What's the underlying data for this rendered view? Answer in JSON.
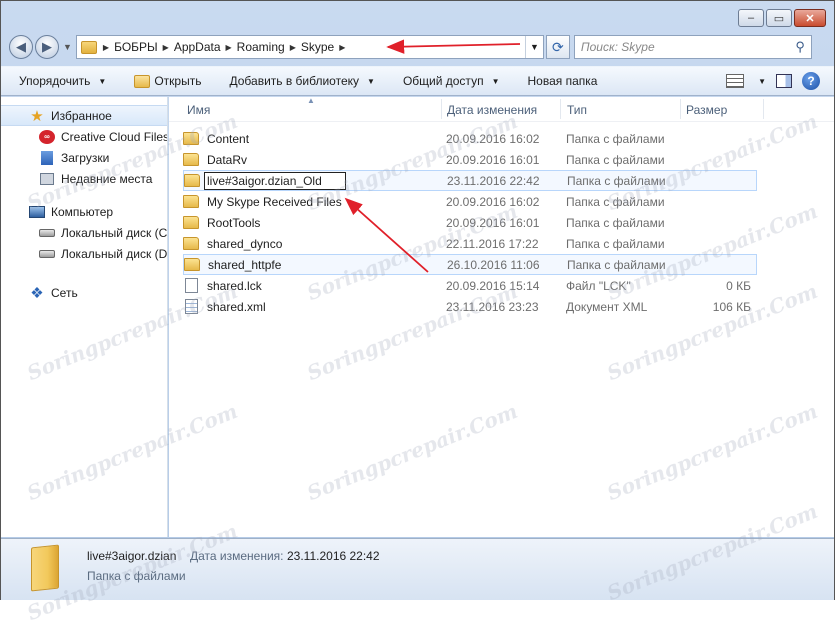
{
  "window": {
    "buttons": {
      "minimize": "–",
      "maximize": "▭",
      "close": "✕"
    }
  },
  "address": {
    "crumbs": [
      "БОБРЫ",
      "AppData",
      "Roaming",
      "Skype"
    ],
    "search_placeholder": "Поиск: Skype"
  },
  "toolbar": {
    "organize": "Упорядочить",
    "open": "Открыть",
    "add_library": "Добавить в библиотеку",
    "share": "Общий доступ",
    "new_folder": "Новая папка"
  },
  "nav": {
    "favorites": "Избранное",
    "creative_cloud": "Creative Cloud Files",
    "downloads": "Загрузки",
    "recent": "Недавние места",
    "computer": "Компьютер",
    "disk_c": "Локальный диск (C:)",
    "disk_d": "Локальный диск (D:)",
    "network": "Сеть"
  },
  "columns": {
    "name": "Имя",
    "date": "Дата изменения",
    "type": "Тип",
    "size": "Размер"
  },
  "files": [
    {
      "name": "Content",
      "date": "20.09.2016 16:02",
      "type": "Папка с файлами",
      "size": "",
      "icon": "folder"
    },
    {
      "name": "DataRv",
      "date": "20.09.2016 16:01",
      "type": "Папка с файлами",
      "size": "",
      "icon": "folder"
    },
    {
      "name": "live#3aigor.dzian_Old",
      "date": "23.11.2016 22:42",
      "type": "Папка с файлами",
      "size": "",
      "icon": "folder",
      "renaming": true
    },
    {
      "name": "My Skype Received Files",
      "date": "20.09.2016 16:02",
      "type": "Папка с файлами",
      "size": "",
      "icon": "folder"
    },
    {
      "name": "RootTools",
      "date": "20.09.2016 16:01",
      "type": "Папка с файлами",
      "size": "",
      "icon": "folder"
    },
    {
      "name": "shared_dynco",
      "date": "22.11.2016 17:22",
      "type": "Папка с файлами",
      "size": "",
      "icon": "folder"
    },
    {
      "name": "shared_httpfe",
      "date": "26.10.2016 11:06",
      "type": "Папка с файлами",
      "size": "",
      "icon": "folder",
      "highlight": true
    },
    {
      "name": "shared.lck",
      "date": "20.09.2016 15:14",
      "type": "Файл \"LCK\"",
      "size": "0 КБ",
      "icon": "file"
    },
    {
      "name": "shared.xml",
      "date": "23.11.2016 23:23",
      "type": "Документ XML",
      "size": "106 КБ",
      "icon": "xml"
    }
  ],
  "details": {
    "name": "live#3aigor.dzian",
    "date_label": "Дата изменения:",
    "date": "23.11.2016 22:42",
    "type": "Папка с файлами"
  },
  "watermark": "Soringpcrepair.Com",
  "colors": {
    "annotation_arrow": "#e0202a",
    "selection": "#cde6ff"
  }
}
